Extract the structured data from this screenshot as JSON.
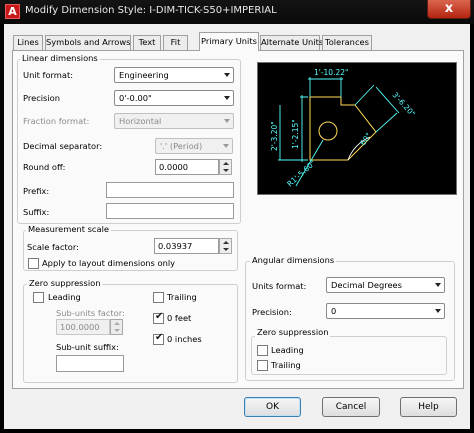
{
  "window": {
    "title": "Modify Dimension Style: I-DIM-TICK-S50+IMPERIAL",
    "close_glyph": "x",
    "app_icon_letter": "A"
  },
  "tabs": [
    {
      "label": "Lines"
    },
    {
      "label": "Symbols and Arrows"
    },
    {
      "label": "Text"
    },
    {
      "label": "Fit"
    },
    {
      "label": "Primary Units",
      "active": true
    },
    {
      "label": "Alternate Units"
    },
    {
      "label": "Tolerances"
    }
  ],
  "linear": {
    "title": "Linear dimensions",
    "unit_format_label": "Unit format:",
    "unit_format_value": "Engineering",
    "precision_label": "Precision",
    "precision_value": "0'-0.00\"",
    "fraction_label": "Fraction format:",
    "fraction_value": "Horizontal",
    "decimal_sep_label": "Decimal separator:",
    "decimal_sep_value": "'.' (Period)",
    "roundoff_label": "Round off:",
    "roundoff_value": "0.0000",
    "prefix_label": "Prefix:",
    "prefix_value": "",
    "suffix_label": "Suffix:",
    "suffix_value": ""
  },
  "measurement": {
    "title": "Measurement scale",
    "scale_label": "Scale factor:",
    "scale_value": "0.03937",
    "apply_layout_label": "Apply to layout dimensions only",
    "apply_layout_checked": false
  },
  "zero_linear": {
    "title": "Zero suppression",
    "leading_label": "Leading",
    "leading_checked": false,
    "trailing_label": "Trailing",
    "trailing_checked": false,
    "subunits_factor_label": "Sub-units factor:",
    "subunits_factor_value": "100.0000",
    "subunit_suffix_label": "Sub-unit suffix:",
    "subunit_suffix_value": "",
    "feet_label": "0 feet",
    "feet_checked": true,
    "inches_label": "0 inches",
    "inches_checked": true
  },
  "angular": {
    "title": "Angular dimensions",
    "units_label": "Units format:",
    "units_value": "Decimal Degrees",
    "precision_label": "Precision:",
    "precision_value": "0",
    "zero_title": "Zero suppression",
    "leading_label": "Leading",
    "leading_checked": false,
    "trailing_label": "Trailing",
    "trailing_checked": false
  },
  "preview": {
    "dims": [
      "1'-10.22\"",
      "1'-2.15\"",
      "2'-3.20\"",
      "3'-6.20\"",
      "60°",
      "R1'-5.60\""
    ],
    "colors": {
      "bg": "#000000",
      "geometry": "#ffdd55",
      "dims": "#55ffff",
      "sweep": "#ffffff"
    }
  },
  "buttons": {
    "ok": "OK",
    "cancel": "Cancel",
    "help": "Help"
  }
}
